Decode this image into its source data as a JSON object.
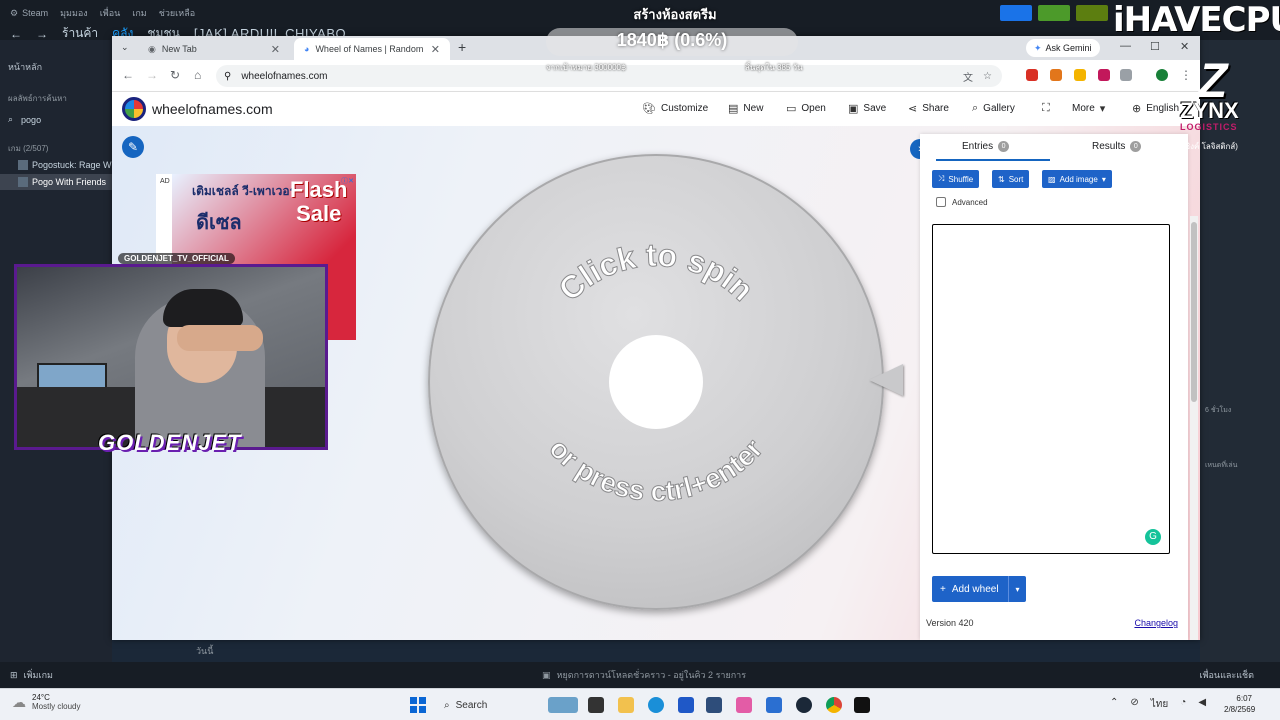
{
  "steam": {
    "menu": [
      "Steam",
      "มุมมอง",
      "เพื่อน",
      "เกม",
      "ช่วยเหลือ"
    ],
    "nav": {
      "store": "ร้านค้า",
      "library": "คลัง",
      "community": "ชุมชน",
      "user": "[JAK] ARDUIL CHIYABO"
    },
    "sidebar": {
      "home": "หน้าหลัก",
      "results": "ผลลัพธ์การค้นหา",
      "search_value": "pogo",
      "games_header": "เกม",
      "games_count": "(2/507)",
      "games": [
        "Pogostuck: Rage W",
        "Pogo With Friends"
      ]
    },
    "today": "วันนี้",
    "add_game": "เพิ่มเกม",
    "downloads": "หยุดการดาวน์โหลดชั่วคราว - อยู่ในคิว 2 รายการ",
    "friends_chat": "เพื่อนและแช็ต",
    "right_panel": {
      "time": "6 ชั่วโมง",
      "text": "เหนดที่เล่น"
    },
    "top_user_short": "[JAK]"
  },
  "stream": {
    "title": "สร้างห้องสตรีม",
    "goal_value": "1840฿ (0.6%)",
    "goal_left": "จากเป้าหมาย 300000฿",
    "goal_right": "สิ้นสุดใน 385 วัน",
    "cam_tag": "GOLDENJET_TV_OFFICIAL",
    "cam_brand": "GOLDENJET",
    "brand_main": "iHAVECPU",
    "sponsor_letter": "Z",
    "sponsor": "ZYNX",
    "sponsor_sub": "LOGISTICS",
    "sponsor_sub2": "(ซิงค์ โลจิสติกส์)"
  },
  "browser": {
    "tabs": [
      {
        "title": "New Tab"
      },
      {
        "title": "Wheel of Names | Random nan"
      }
    ],
    "ask_gemini": "Ask Gemini",
    "url": "wheelofnames.com"
  },
  "site": {
    "name": "wheelofnames.com",
    "nav": {
      "customize": "Customize",
      "new": "New",
      "open": "Open",
      "save": "Save",
      "share": "Share",
      "gallery": "Gallery",
      "more": "More",
      "language": "English"
    },
    "ad": {
      "label": "AD",
      "line1": "เติมเชลล์ วี-เพาเวอร์",
      "line2": "ดีเซล",
      "flash1": "Flash",
      "flash2": "Sale"
    },
    "wheel": {
      "top_text": "Click to spin",
      "bottom_text": "or press ctrl+enter"
    },
    "panel": {
      "entries_label": "Entries",
      "entries_count": "0",
      "results_label": "Results",
      "results_count": "0",
      "shuffle": "Shuffle",
      "sort": "Sort",
      "add_image": "Add image",
      "advanced": "Advanced",
      "add_wheel": "Add wheel",
      "version": "Version 420",
      "changelog": "Changelog"
    }
  },
  "taskbar": {
    "temp": "24°C",
    "condition": "Mostly cloudy",
    "search": "Search",
    "lang": "ไทย",
    "time": "6:07",
    "date": "2/8/2569"
  }
}
